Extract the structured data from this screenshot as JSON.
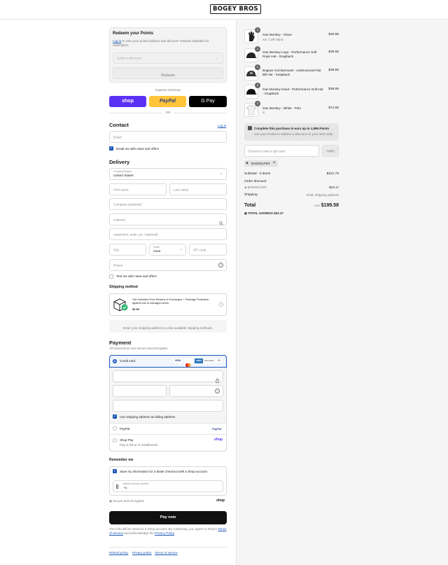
{
  "header": {
    "logo_text": "BOGEY BROS"
  },
  "redeem": {
    "title": "Redeem your Points",
    "desc_link": "Log in",
    "desc_text": " to view your points balance and discover rewards available for redemption.",
    "select_placeholder": "Select a discount",
    "button": "Redeem"
  },
  "express": {
    "label": "Express checkout",
    "shop": "shop",
    "paypal": "PayPal",
    "gpay": "G Pay",
    "or": "OR"
  },
  "contact": {
    "title": "Contact",
    "login": "Log in",
    "email_placeholder": "Email",
    "news_label": "Email me with news and offers"
  },
  "delivery": {
    "title": "Delivery",
    "country_label": "Country/Region",
    "country_value": "United States",
    "first_name": "First name",
    "last_name": "Last name",
    "company": "Company (optional)",
    "address": "Address",
    "apartment": "Apartment, suite, etc. (optional)",
    "city": "City",
    "state_label": "State",
    "state_value": "Iowa",
    "zip": "ZIP code",
    "phone": "Phone",
    "text_news": "Text me with news and offers"
  },
  "shipping_method": {
    "title": "Shipping method",
    "protection_text": "Get Unlimited Free Returns & Exchanges + Package Protection against lost or damaged items",
    "protection_price": "$2.98",
    "notice": "Enter your shipping address to view available shipping methods."
  },
  "payment": {
    "title": "Payment",
    "subtitle": "All transactions are secure and encrypted.",
    "credit_card": "Credit card",
    "card_brands": [
      "VISA",
      "MC",
      "AMEX",
      "DISCOVER",
      "+5"
    ],
    "billing_same": "Use shipping address as billing address",
    "paypal": "PayPal",
    "paypal_logo": "PayPal",
    "shoppay": "Shop Pay",
    "shoppay_sub": "Pay in full or in installments",
    "shoppay_logo": "shop"
  },
  "remember": {
    "title": "Remember me",
    "save_label": "Save my information for a faster checkout with a Shop account",
    "mobile_label": "Mobile phone number",
    "mobile_value": "+1",
    "secure": "Secure and encrypted",
    "shop_logo": "shop"
  },
  "pay_button": "Pay now",
  "footer_text": {
    "part1": "Your info will be saved to a Shop account. By continuing, you agree to Shop's ",
    "terms": "Terms of Service",
    "part2": " and acknowledge the ",
    "privacy": "Privacy Policy",
    "part3": "."
  },
  "footer_links": [
    "Refund policy",
    "Privacy policy",
    "Terms of service"
  ],
  "cart": {
    "items": [
      {
        "name": "Gas Monkey - Glove",
        "variant": "XS / Left Hand",
        "price": "$29.95",
        "qty": "1"
      },
      {
        "name": "Gas Monkey Logo - Performance Golf Rope Hat - Snapback",
        "variant": "",
        "price": "$38.95",
        "qty": "1"
      },
      {
        "name": "Bogeys And Burnouts - Unstructured Flat Bill Hat - Snapback",
        "variant": "",
        "price": "$38.95",
        "qty": "1"
      },
      {
        "name": "Gas Monkey Head - Performance Golf Hat - Snapback",
        "variant": "",
        "price": "$38.95",
        "qty": "1"
      },
      {
        "name": "Gas Monkey - White - Polo",
        "variant": "S",
        "price": "$74.95",
        "qty": "1"
      }
    ],
    "points_title": "Complete this purchase to earn up to 1,995 Points",
    "points_sub": "Use your Points to redeem a discount on your next order.",
    "discount_placeholder": "Discount code or gift card",
    "apply": "Apply",
    "applied_code": "BADGOLFER",
    "subtotal_label": "Subtotal · 5 items",
    "subtotal_value": "$221.75",
    "order_discount_label": "Order discount",
    "discount_code": "BADGOLFER",
    "discount_value": "- $22.17",
    "shipping_label": "Shipping",
    "shipping_value": "Enter shipping address",
    "total_label": "Total",
    "currency": "USD",
    "total_value": "$199.58",
    "savings_label": "TOTAL SAVINGS",
    "savings_value": "$22.17"
  }
}
